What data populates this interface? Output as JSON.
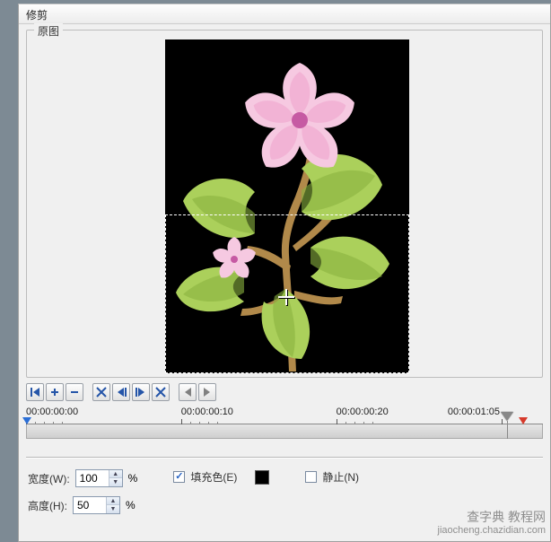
{
  "window": {
    "title": "修剪"
  },
  "preview": {
    "group_label": "原图"
  },
  "toolbar": {
    "icons": [
      "go-start",
      "step-back",
      "step-fwd",
      "mark-in",
      "prev-frame",
      "next-frame",
      "mark-out",
      "loop-in",
      "loop-out"
    ]
  },
  "timeline": {
    "ticks": [
      {
        "label": "00:00:00:00",
        "pos": 0
      },
      {
        "label": "00:00:00:10",
        "pos": 0.3
      },
      {
        "label": "00:00:00:20",
        "pos": 0.6
      },
      {
        "label": "00:00:01:05",
        "pos": 0.93
      }
    ],
    "playhead_pos": 0.93,
    "in_pos": 0.0,
    "out_pos": 0.955
  },
  "options": {
    "width_label": "宽度(W):",
    "width_value": "100",
    "height_label": "高度(H):",
    "height_value": "50",
    "spin_up": "▲",
    "spin_down": "▼",
    "percent": "%",
    "fill_label": "填充色(E)",
    "fill_checked": true,
    "fill_color": "#000000",
    "still_label": "静止(N)",
    "still_checked": false
  },
  "watermark": {
    "line1": "查字典 教程网",
    "line2": "jiaocheng.chazidian.com"
  }
}
